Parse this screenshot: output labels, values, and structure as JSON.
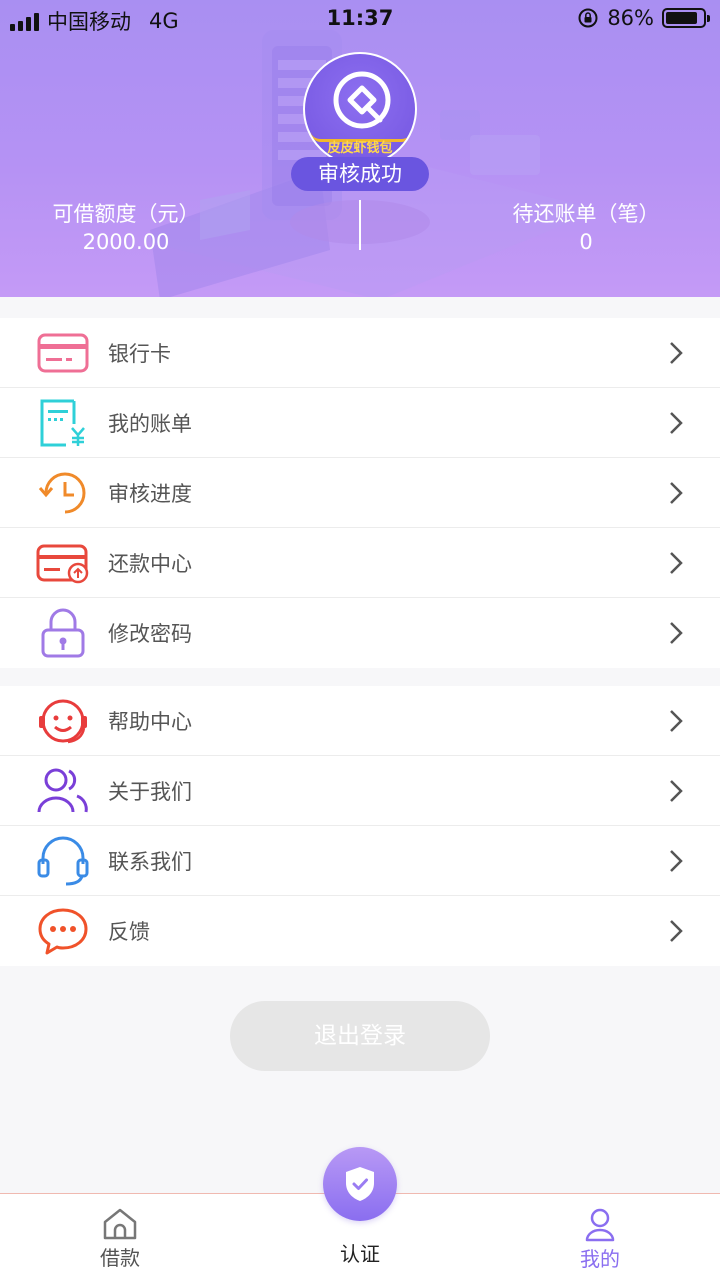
{
  "status_bar": {
    "carrier": "中国移动",
    "network": "4G",
    "time": "11:37",
    "battery": "86%",
    "battery_level": 0.86
  },
  "profile": {
    "brand_name": "皮皮虾钱包",
    "status": "审核成功"
  },
  "stats": {
    "credit_label": "可借额度（元）",
    "credit_value": "2000.00",
    "bills_label": "待还账单（笔）",
    "bills_value": "0"
  },
  "menu_group_1": [
    {
      "label": "银行卡",
      "icon": "bank-card-icon",
      "color": "#ef6f95"
    },
    {
      "label": "我的账单",
      "icon": "bill-icon",
      "color": "#2fd0d8"
    },
    {
      "label": "审核进度",
      "icon": "clock-history-icon",
      "color": "#f08a2a"
    },
    {
      "label": "还款中心",
      "icon": "repayment-card-icon",
      "color": "#e8483c"
    },
    {
      "label": "修改密码",
      "icon": "lock-icon",
      "color": "#a07ae6"
    }
  ],
  "menu_group_2": [
    {
      "label": "帮助中心",
      "icon": "smiley-support-icon",
      "color": "#e83c3c"
    },
    {
      "label": "关于我们",
      "icon": "users-icon",
      "color": "#7a3fd8"
    },
    {
      "label": "联系我们",
      "icon": "headset-icon",
      "color": "#3a8be6"
    },
    {
      "label": "反馈",
      "icon": "chat-bubble-icon",
      "color": "#f0522a"
    }
  ],
  "logout_label": "退出登录",
  "tabbar": {
    "loan": "借款",
    "auth": "认证",
    "mine": "我的"
  },
  "colors": {
    "accent": "#8a6ef0",
    "header_start": "#a98ff2",
    "header_end": "#c49af6"
  }
}
